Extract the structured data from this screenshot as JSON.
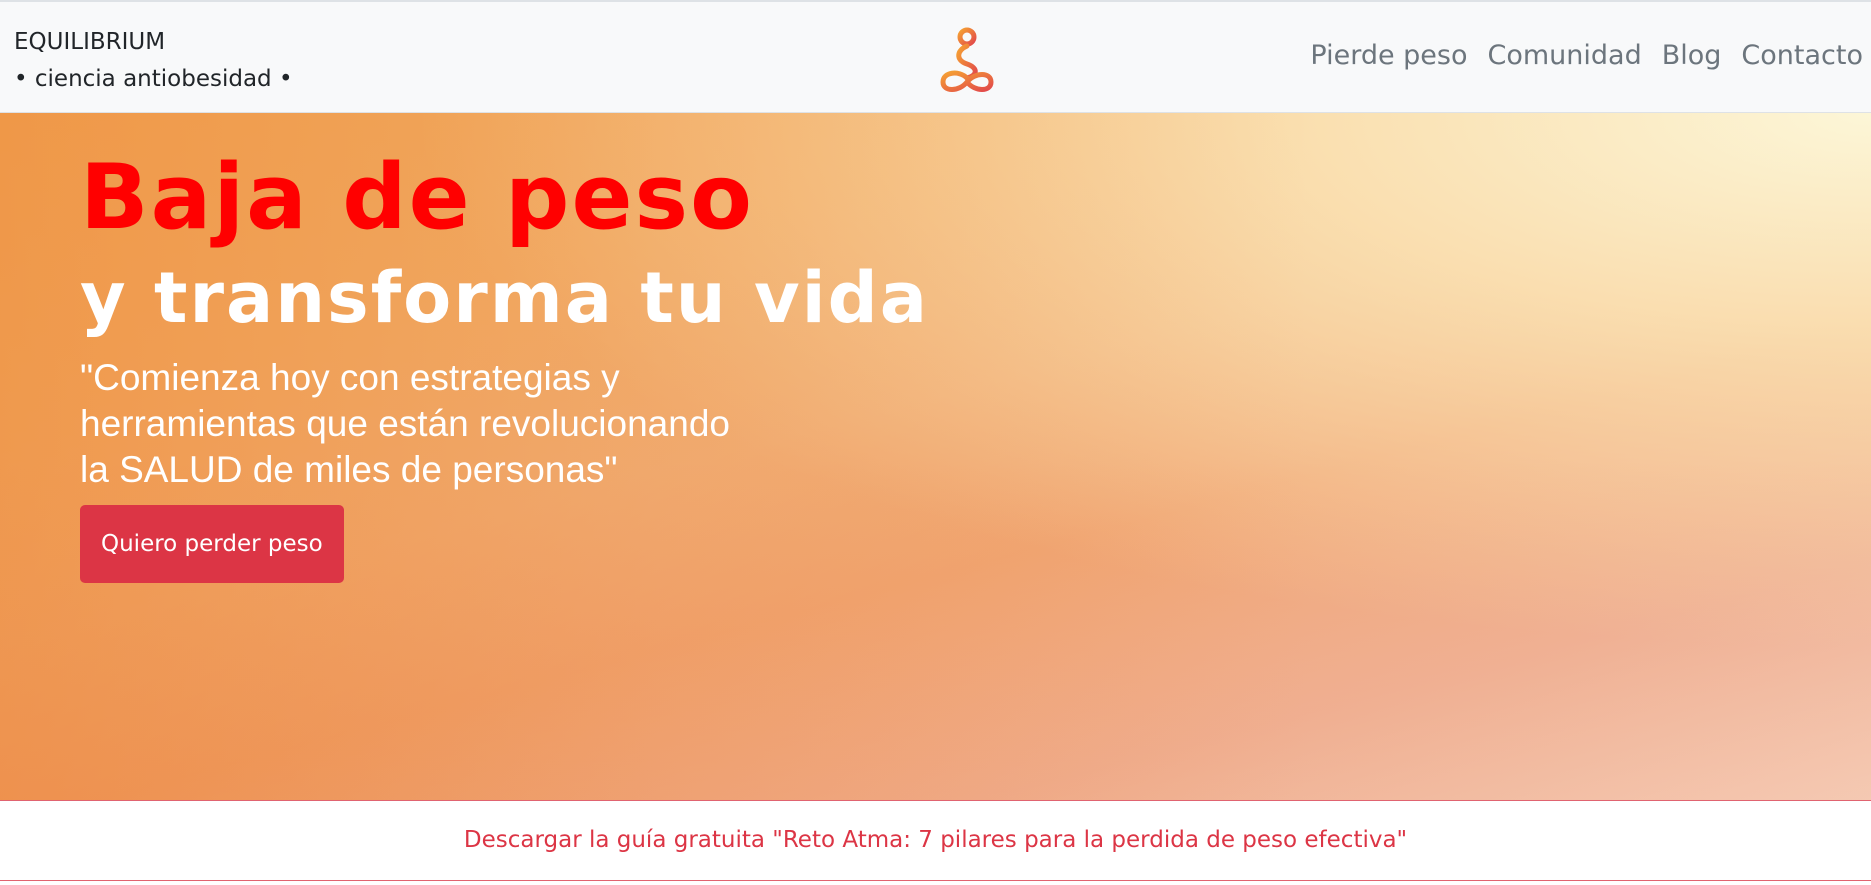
{
  "navbar": {
    "brand_line1": "EQUILIBRIUM",
    "brand_line2": "• ciencia antiobesidad •",
    "logo_icon": "meditation-figure-icon",
    "links": [
      "Pierde peso",
      "Comunidad",
      "Blog",
      "Contacto"
    ]
  },
  "hero": {
    "headline_red": "Baja de peso",
    "headline_white": "y transforma tu vida",
    "quote_lines": [
      "\"Comienza hoy con estrategias y",
      "herramientas que están revolucionando",
      "la SALUD de miles de personas\""
    ],
    "cta_label": "Quiero perder peso"
  },
  "download": {
    "label": "Descargar la guía gratuita \"Reto Atma: 7 pilares para la perdida de peso efectiva\""
  },
  "colors": {
    "accent_red": "#ff0000",
    "button_red": "#dc3545",
    "hero_orange": "#f3b060",
    "navbar_bg": "#f8f9fa"
  }
}
